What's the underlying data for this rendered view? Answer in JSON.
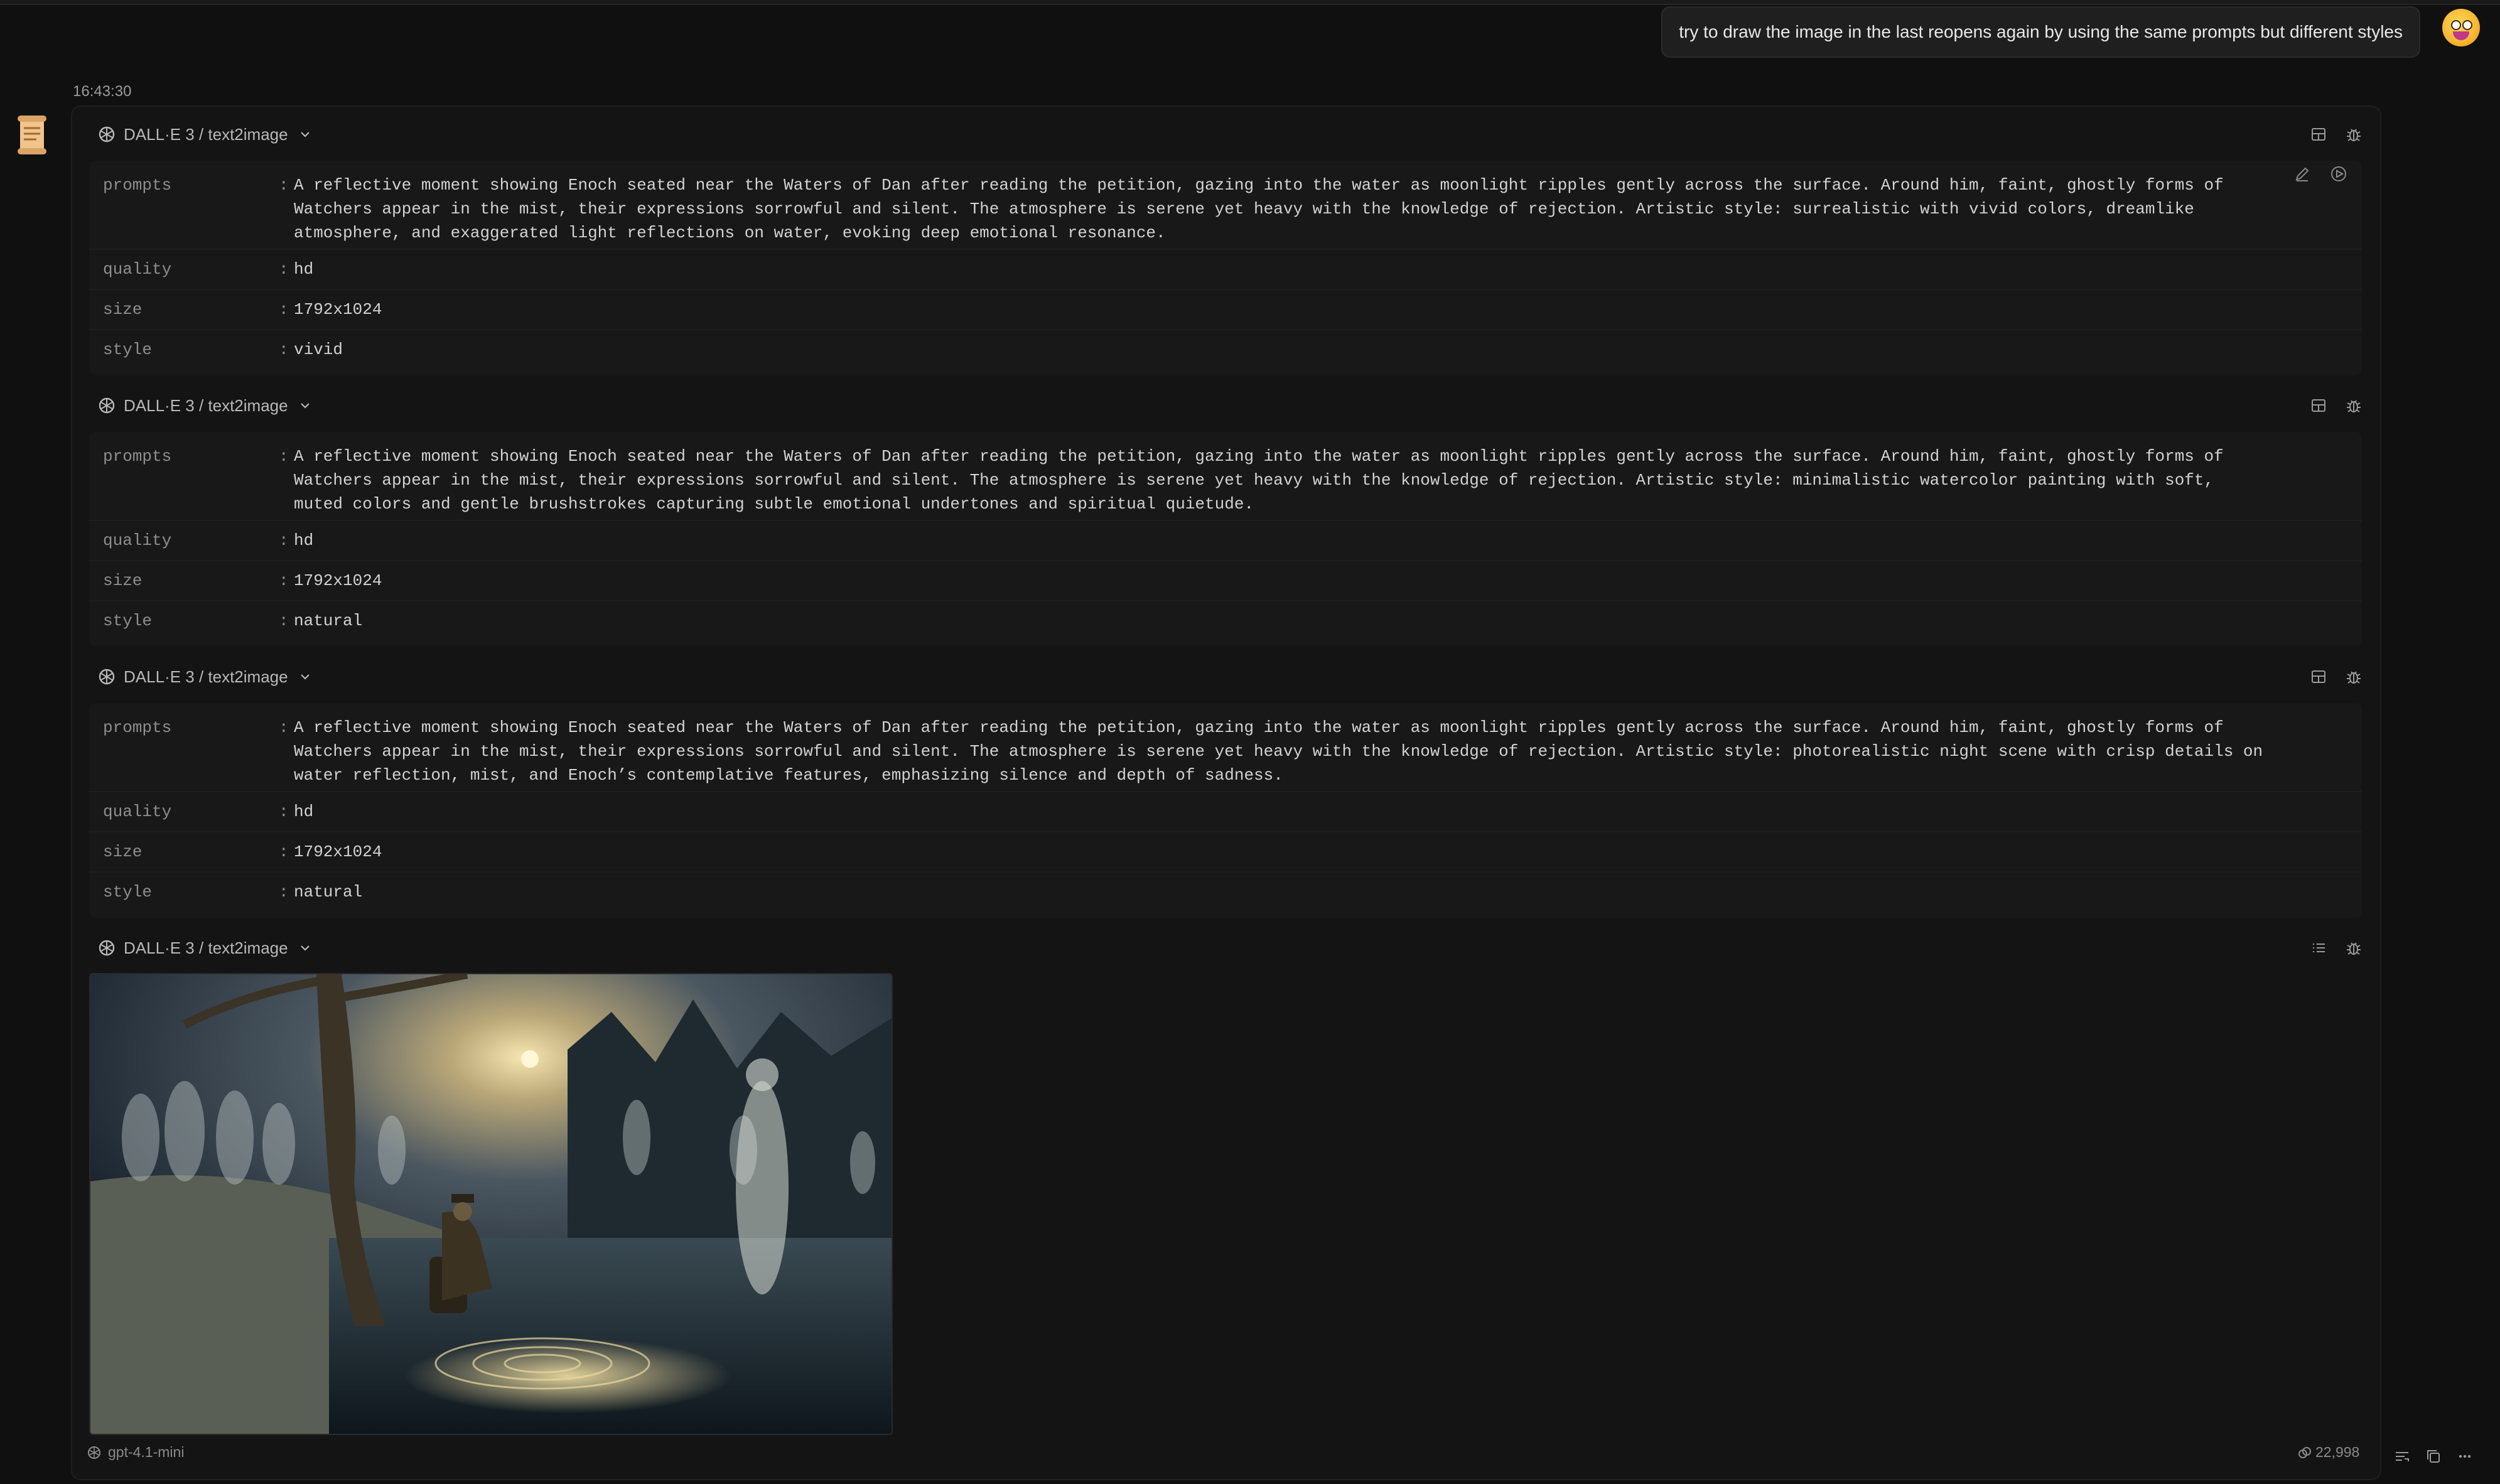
{
  "user_message": "try to draw the image in the last reopens again by using the same prompts but different styles",
  "timestamp": "16:43:30",
  "model": "gpt-4.1-mini",
  "tokens": "22,998",
  "colors": {
    "background": "#101010",
    "card": "#181818",
    "accent_avatar": "#f6b631"
  },
  "tool_calls": [
    {
      "title": "DALL·E 3 / text2image",
      "params": [
        {
          "key": "prompts",
          "value": "A reflective moment showing Enoch seated near the Waters of Dan after reading the petition, gazing into the water as moonlight ripples gently across the surface. Around him, faint, ghostly forms of Watchers appear in the mist, their expressions sorrowful and silent. The atmosphere is serene yet heavy with the knowledge of rejection. Artistic style: surrealistic with vivid colors, dreamlike atmosphere, and exaggerated light reflections on water, evoking deep emotional resonance."
        },
        {
          "key": "quality",
          "value": "hd"
        },
        {
          "key": "size",
          "value": "1792x1024"
        },
        {
          "key": "style",
          "value": "vivid"
        }
      ]
    },
    {
      "title": "DALL·E 3 / text2image",
      "params": [
        {
          "key": "prompts",
          "value": "A reflective moment showing Enoch seated near the Waters of Dan after reading the petition, gazing into the water as moonlight ripples gently across the surface. Around him, faint, ghostly forms of Watchers appear in the mist, their expressions sorrowful and silent. The atmosphere is serene yet heavy with the knowledge of rejection. Artistic style: minimalistic watercolor painting with soft, muted colors and gentle brushstrokes capturing subtle emotional undertones and spiritual quietude."
        },
        {
          "key": "quality",
          "value": "hd"
        },
        {
          "key": "size",
          "value": "1792x1024"
        },
        {
          "key": "style",
          "value": "natural"
        }
      ]
    },
    {
      "title": "DALL·E 3 / text2image",
      "params": [
        {
          "key": "prompts",
          "value": "A reflective moment showing Enoch seated near the Waters of Dan after reading the petition, gazing into the water as moonlight ripples gently across the surface. Around him, faint, ghostly forms of Watchers appear in the mist, their expressions sorrowful and silent. The atmosphere is serene yet heavy with the knowledge of rejection. Artistic style: photorealistic night scene with crisp details on water reflection, mist, and Enoch’s contemplative features, emphasizing silence and depth of sadness."
        },
        {
          "key": "quality",
          "value": "hd"
        },
        {
          "key": "size",
          "value": "1792x1024"
        },
        {
          "key": "style",
          "value": "natural"
        }
      ]
    },
    {
      "title": "DALL·E 3 / text2image",
      "params": []
    }
  ]
}
